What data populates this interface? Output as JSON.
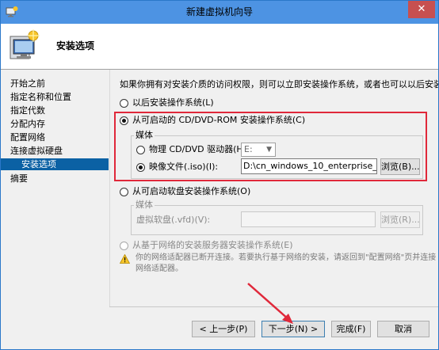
{
  "window": {
    "title": "新建虚拟机向导",
    "close_glyph": "✕"
  },
  "header": {
    "title": "安装选项"
  },
  "nav": {
    "items": [
      {
        "label": "开始之前"
      },
      {
        "label": "指定名称和位置"
      },
      {
        "label": "指定代数"
      },
      {
        "label": "分配内存"
      },
      {
        "label": "配置网络"
      },
      {
        "label": "连接虚拟硬盘"
      },
      {
        "label": "安装选项"
      },
      {
        "label": "摘要"
      }
    ]
  },
  "content": {
    "description": "如果你拥有对安装介质的访问权限，则可以立即安装操作系统，或者也可以以后安装。",
    "option_later": "以后安装操作系统(L)",
    "option_cd": "从可启动的 CD/DVD-ROM 安装操作系统(C)",
    "media_group": "媒体",
    "physical_drive_label": "物理 CD/DVD 驱动器(H):",
    "physical_drive_value": "E:",
    "image_file_label": "映像文件(.iso)(I):",
    "image_file_value": "D:\\cn_windows_10_enterprise_x64",
    "browse_label": "浏览(B)...",
    "option_floppy": "从可启动软盘安装操作系统(O)",
    "floppy_media_group": "媒体",
    "virtual_floppy_label": "虚拟软盘(.vfd)(V):",
    "floppy_browse_label": "浏览(R)...",
    "option_network": "从基于网络的安装服务器安装操作系统(E)",
    "network_warning": "你的网络适配器已断开连接。若要执行基于网络的安装，请返回到\"配置网络\"页并连接网络适配器。"
  },
  "footer": {
    "prev_label": "< 上一步(P)",
    "next_label": "下一步(N) >",
    "finish_label": "完成(F)",
    "cancel_label": "取消"
  },
  "colors": {
    "titlebar": "#4d93e3",
    "selection": "#0b61a4",
    "highlight_box": "#e0283a"
  }
}
